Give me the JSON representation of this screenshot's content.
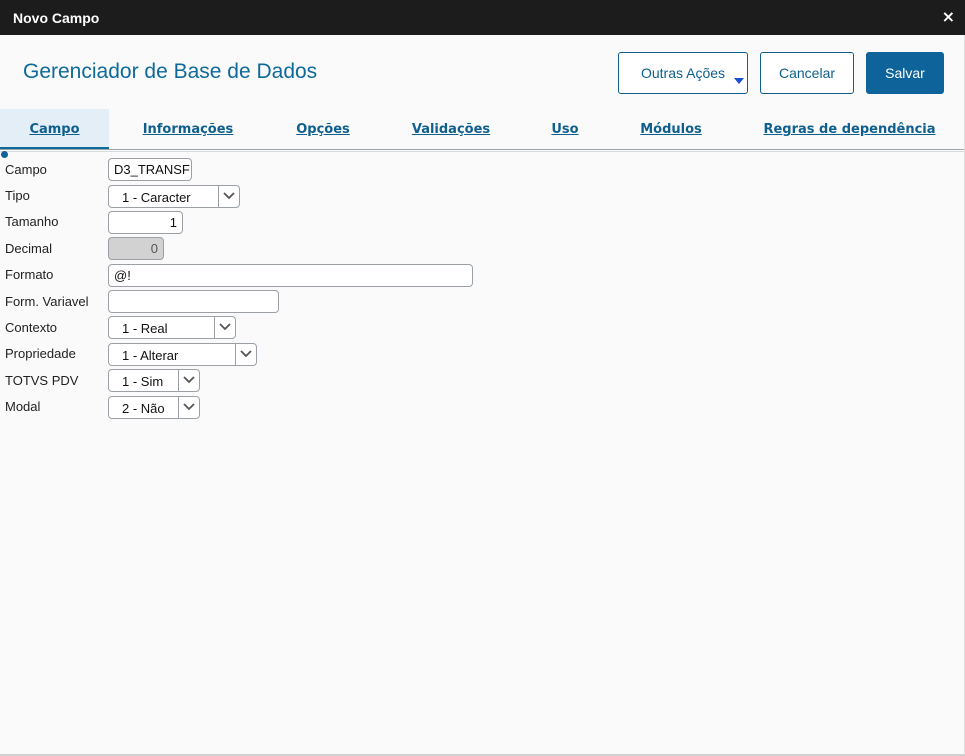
{
  "window": {
    "title": "Novo Campo",
    "close_icon": "×"
  },
  "header": {
    "title": "Gerenciador de Base de Dados",
    "buttons": {
      "outras_acoes": "Outras Ações",
      "cancelar": "Cancelar",
      "salvar": "Salvar"
    }
  },
  "tabs": [
    {
      "label": "Campo",
      "active": true
    },
    {
      "label": "Informações",
      "active": false
    },
    {
      "label": "Opções",
      "active": false
    },
    {
      "label": "Validações",
      "active": false
    },
    {
      "label": "Uso",
      "active": false
    },
    {
      "label": "Módulos",
      "active": false
    },
    {
      "label": "Regras de dependência",
      "active": false
    }
  ],
  "form": {
    "campo": {
      "label": "Campo",
      "value": "D3_TRANSF"
    },
    "tipo": {
      "label": "Tipo",
      "value": "1 - Caracter"
    },
    "tamanho": {
      "label": "Tamanho",
      "value": "1"
    },
    "decimal": {
      "label": "Decimal",
      "value": "0",
      "disabled": true
    },
    "formato": {
      "label": "Formato",
      "value": "@!"
    },
    "form_variavel": {
      "label": "Form. Variavel",
      "value": ""
    },
    "contexto": {
      "label": "Contexto",
      "value": "1 - Real"
    },
    "propriedade": {
      "label": "Propriedade",
      "value": "1 - Alterar"
    },
    "totvs_pdv": {
      "label": "TOTVS PDV",
      "value": "1 - Sim"
    },
    "modal": {
      "label": "Modal",
      "value": "2 - Não"
    }
  },
  "colors": {
    "titlebar": "#1c1c1c",
    "accent": "#0e649a",
    "primary_button": "#0e649a",
    "tab_active_bg": "#e3eef7"
  }
}
